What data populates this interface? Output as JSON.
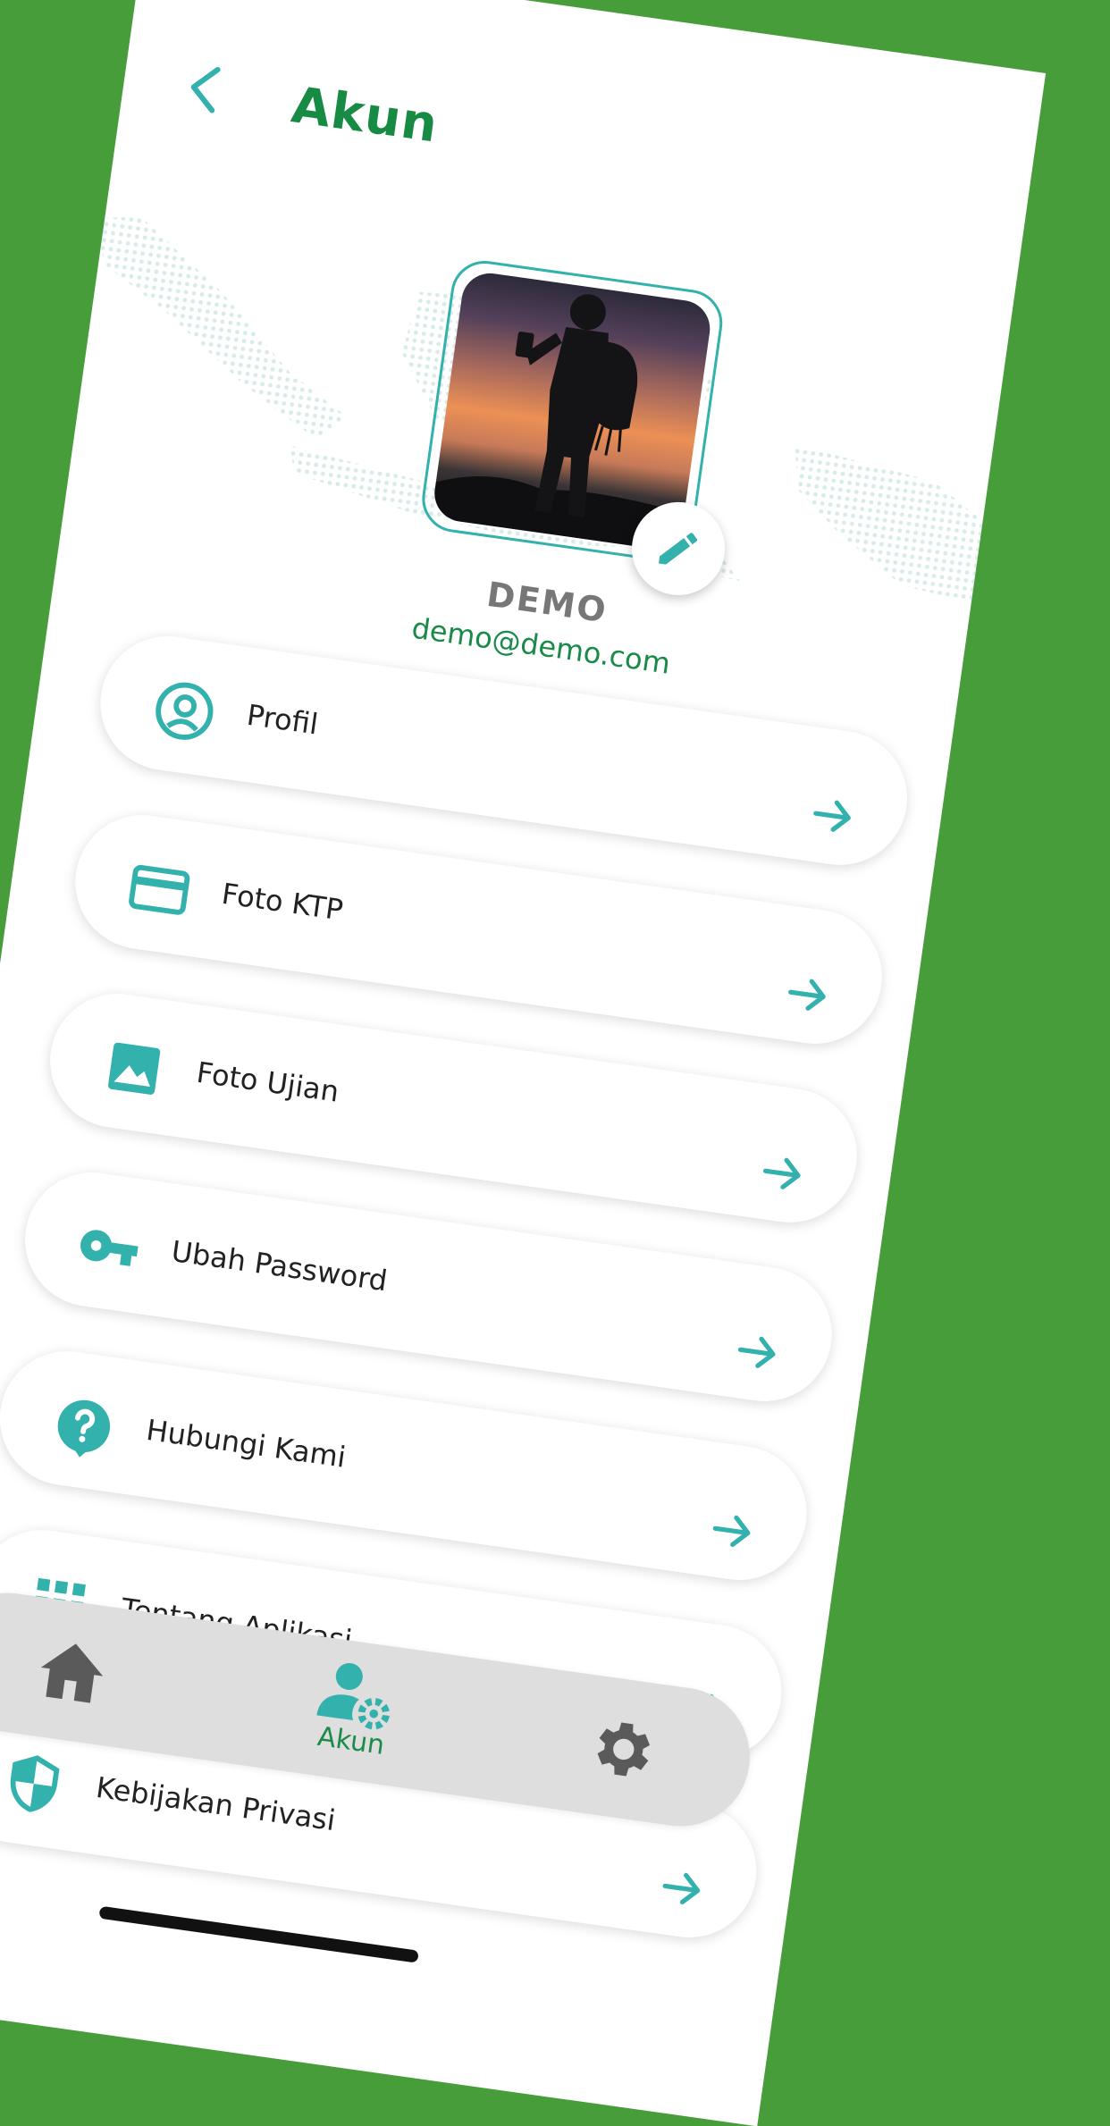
{
  "header": {
    "title": "Akun"
  },
  "profile": {
    "name": "DEMO",
    "email": "demo@demo.com"
  },
  "menu": [
    {
      "label": "Profil",
      "icon": "account-circle-icon"
    },
    {
      "label": "Foto KTP",
      "icon": "credit-card-icon"
    },
    {
      "label": "Foto Ujian",
      "icon": "image-icon"
    },
    {
      "label": "Ubah Password",
      "icon": "key-icon"
    },
    {
      "label": "Hubungi Kami",
      "icon": "help-bubble-icon"
    },
    {
      "label": "Tentang Aplikasi",
      "icon": "grid-icon"
    },
    {
      "label": "Kebijakan Privasi",
      "icon": "shield-icon"
    }
  ],
  "nav": {
    "akun_label": "Akun"
  },
  "colors": {
    "accent": "#33b1ad",
    "primary": "#178a44",
    "background": "#489d3b"
  }
}
